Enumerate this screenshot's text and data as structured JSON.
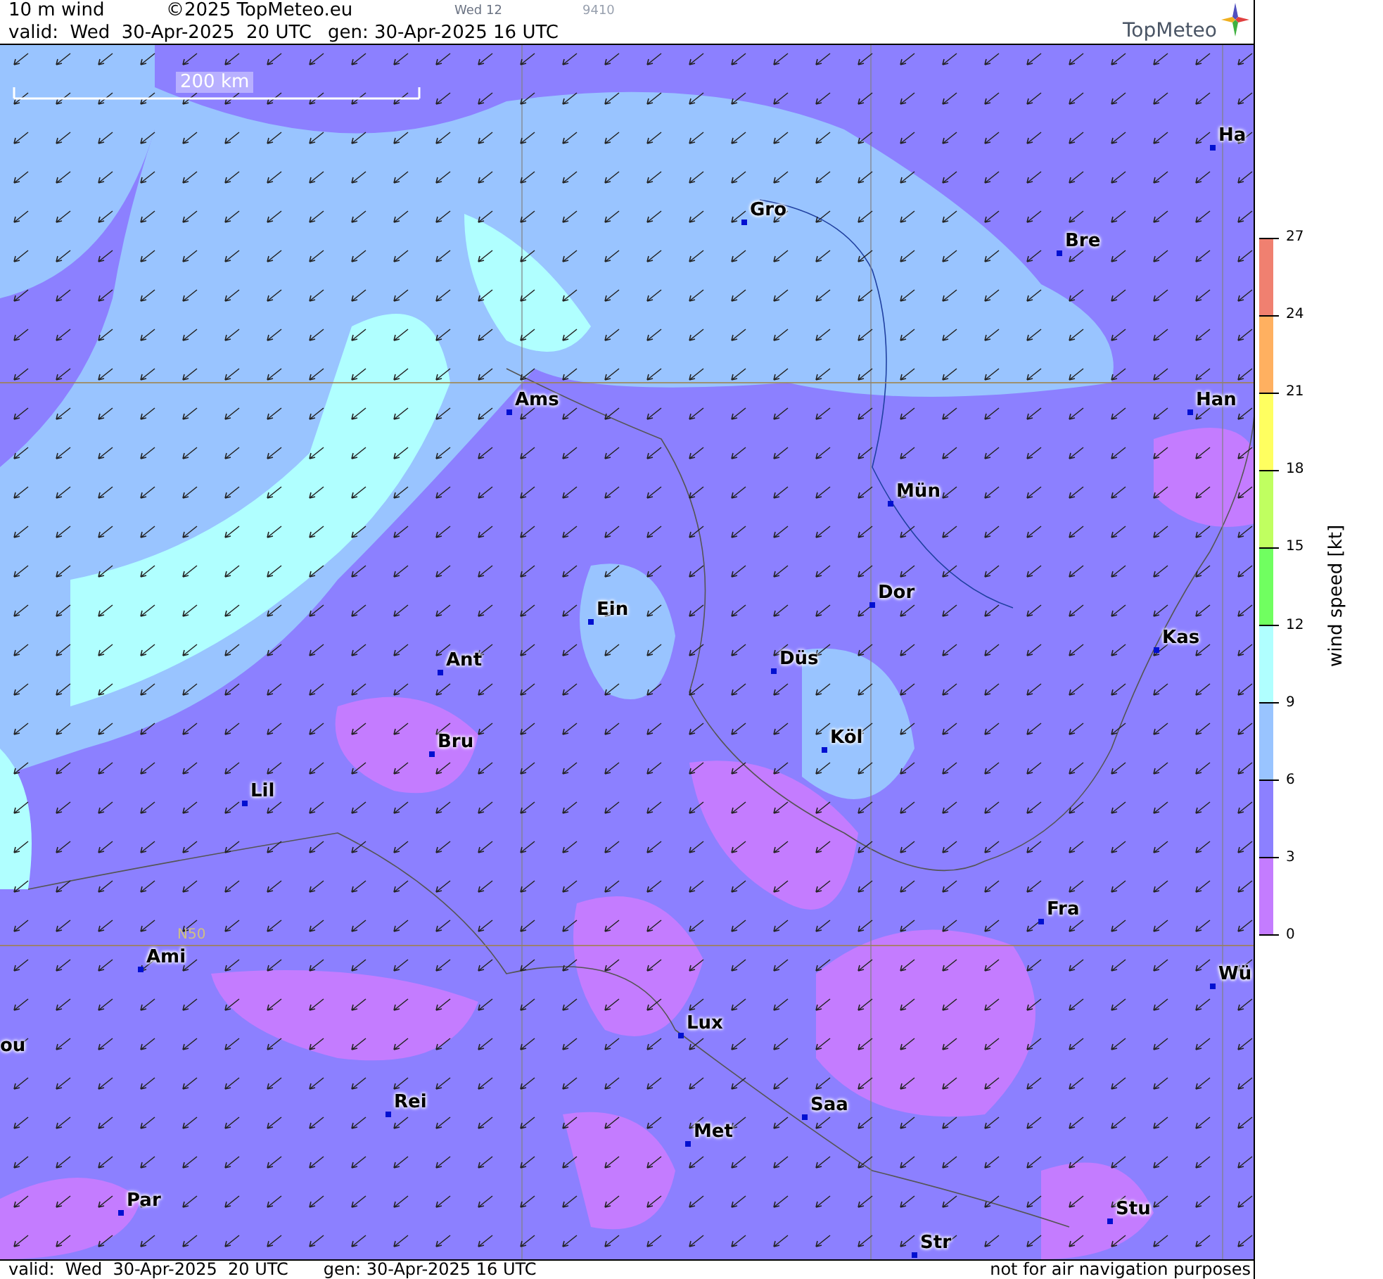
{
  "header": {
    "title": "10 m wind",
    "copyright": "©2025 TopMeteo.eu",
    "run_label": "Wed 12",
    "code": "9410",
    "valid": "valid:  Wed  30-Apr-2025  20 UTC",
    "generated": "gen: 30-Apr-2025 16 UTC",
    "logo": "TopMeteo"
  },
  "map": {
    "scale_label": "200 km",
    "latitude_label": "N50",
    "cities": [
      {
        "name": "Ha"
      },
      {
        "name": "Gro"
      },
      {
        "name": "Bre"
      },
      {
        "name": "Ams"
      },
      {
        "name": "Han"
      },
      {
        "name": "Mün"
      },
      {
        "name": "Dor"
      },
      {
        "name": "Ein"
      },
      {
        "name": "Kas"
      },
      {
        "name": "Düs"
      },
      {
        "name": "Ant"
      },
      {
        "name": "Köl"
      },
      {
        "name": "Bru"
      },
      {
        "name": "Lil"
      },
      {
        "name": "Fra"
      },
      {
        "name": "Ami"
      },
      {
        "name": "Wü"
      },
      {
        "name": "Lux"
      },
      {
        "name": "ou"
      },
      {
        "name": "Rei"
      },
      {
        "name": "Saa"
      },
      {
        "name": "Met"
      },
      {
        "name": "Par"
      },
      {
        "name": "Stu"
      },
      {
        "name": "Str"
      }
    ]
  },
  "legend": {
    "title": "wind speed [kt]",
    "ticks": [
      "27",
      "24",
      "21",
      "18",
      "15",
      "12",
      "9",
      "6",
      "3",
      "0"
    ],
    "segments": [
      {
        "color": "#f08070"
      },
      {
        "color": "#ffb060"
      },
      {
        "color": "#ffff60"
      },
      {
        "color": "#c0ff60"
      },
      {
        "color": "#70ff60"
      },
      {
        "color": "#b0ffff"
      },
      {
        "color": "#99c4ff"
      },
      {
        "color": "#8c80ff"
      },
      {
        "color": "#c47cff"
      }
    ]
  },
  "footer": {
    "valid": "valid:  Wed  30-Apr-2025  20 UTC",
    "generated": "gen: 30-Apr-2025 16 UTC",
    "notice": "not for air navigation purposes"
  }
}
